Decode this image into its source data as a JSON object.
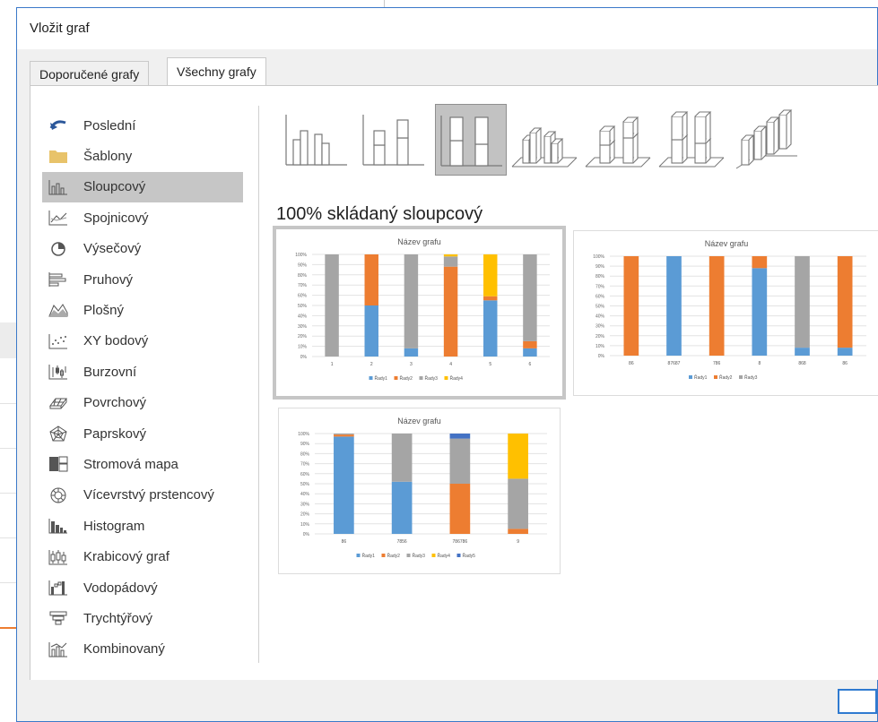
{
  "dialog": {
    "title": "Vložit graf",
    "tabs": [
      "Doporučené grafy",
      "Všechny grafy"
    ],
    "active_tab": "Všechny grafy"
  },
  "categories": [
    {
      "label": "Poslední",
      "icon": "recent-icon"
    },
    {
      "label": "Šablony",
      "icon": "folder-icon"
    },
    {
      "label": "Sloupcový",
      "icon": "column-chart-icon",
      "selected": true
    },
    {
      "label": "Spojnicový",
      "icon": "line-chart-icon"
    },
    {
      "label": "Výsečový",
      "icon": "pie-chart-icon"
    },
    {
      "label": "Pruhový",
      "icon": "bar-chart-icon"
    },
    {
      "label": "Plošný",
      "icon": "area-chart-icon"
    },
    {
      "label": "XY bodový",
      "icon": "scatter-chart-icon"
    },
    {
      "label": "Burzovní",
      "icon": "stock-chart-icon"
    },
    {
      "label": "Povrchový",
      "icon": "surface-chart-icon"
    },
    {
      "label": "Paprskový",
      "icon": "radar-chart-icon"
    },
    {
      "label": "Stromová mapa",
      "icon": "treemap-icon"
    },
    {
      "label": "Vícevrstvý prstencový",
      "icon": "sunburst-icon"
    },
    {
      "label": "Histogram",
      "icon": "histogram-icon"
    },
    {
      "label": "Krabicový graf",
      "icon": "box-whisker-icon"
    },
    {
      "label": "Vodopádový",
      "icon": "waterfall-icon"
    },
    {
      "label": "Trychtýřový",
      "icon": "funnel-icon"
    },
    {
      "label": "Kombinovaný",
      "icon": "combo-chart-icon"
    }
  ],
  "subtypes": [
    {
      "name": "clustered-column-icon"
    },
    {
      "name": "stacked-column-icon"
    },
    {
      "name": "percent-stacked-column-icon",
      "selected": true
    },
    {
      "name": "3d-clustered-column-icon"
    },
    {
      "name": "3d-stacked-column-icon"
    },
    {
      "name": "3d-percent-stacked-column-icon"
    },
    {
      "name": "3d-column-icon"
    }
  ],
  "subtype_title": "100% skládaný sloupcový",
  "colors": {
    "Řady1": "#5b9bd5",
    "Řady2": "#ed7d31",
    "Řady3": "#a5a5a5",
    "Řady4": "#ffc000",
    "Řady5": "#4472c4",
    "accent": "#3b79c9"
  },
  "chart_data": [
    {
      "type": "bar",
      "stacked": "percent",
      "title": "Název grafu",
      "categories": [
        "1",
        "2",
        "3",
        "4",
        "5",
        "6"
      ],
      "series": [
        {
          "name": "Řady1",
          "values": [
            0,
            50,
            8,
            0,
            55,
            8
          ]
        },
        {
          "name": "Řady2",
          "values": [
            0,
            50,
            0,
            88,
            4,
            7
          ]
        },
        {
          "name": "Řady3",
          "values": [
            100,
            0,
            92,
            10,
            0,
            85
          ]
        },
        {
          "name": "Řady4",
          "values": [
            0,
            0,
            0,
            2,
            41,
            0
          ]
        }
      ],
      "yticks": [
        "100%",
        "90%",
        "80%",
        "70%",
        "60%",
        "50%",
        "40%",
        "30%",
        "20%",
        "10%",
        "0%"
      ],
      "legend": "bottom"
    },
    {
      "type": "bar",
      "stacked": "percent",
      "title": "Název grafu",
      "categories": [
        "86",
        "87687",
        "786",
        "8",
        "868",
        "86"
      ],
      "series": [
        {
          "name": "Řady1",
          "values": [
            0,
            100,
            0,
            88,
            8,
            8
          ]
        },
        {
          "name": "Řady2",
          "values": [
            100,
            0,
            100,
            12,
            0,
            92
          ]
        },
        {
          "name": "Řady3",
          "values": [
            0,
            0,
            0,
            0,
            92,
            0
          ]
        }
      ],
      "yticks": [
        "100%",
        "90%",
        "80%",
        "70%",
        "60%",
        "50%",
        "40%",
        "30%",
        "20%",
        "10%",
        "0%"
      ],
      "legend": "bottom"
    },
    {
      "type": "bar",
      "stacked": "percent",
      "title": "Název grafu",
      "categories": [
        "86",
        "7856",
        "786786",
        "9"
      ],
      "series": [
        {
          "name": "Řady1",
          "values": [
            97,
            52,
            0,
            0
          ]
        },
        {
          "name": "Řady2",
          "values": [
            2,
            0,
            50,
            5
          ]
        },
        {
          "name": "Řady3",
          "values": [
            1,
            48,
            45,
            50
          ]
        },
        {
          "name": "Řady4",
          "values": [
            0,
            0,
            0,
            45
          ]
        },
        {
          "name": "Řady5",
          "values": [
            0,
            0,
            5,
            0
          ]
        }
      ],
      "yticks": [
        "100%",
        "90%",
        "80%",
        "70%",
        "60%",
        "50%",
        "40%",
        "30%",
        "20%",
        "10%",
        "0%"
      ],
      "legend": "bottom"
    }
  ]
}
